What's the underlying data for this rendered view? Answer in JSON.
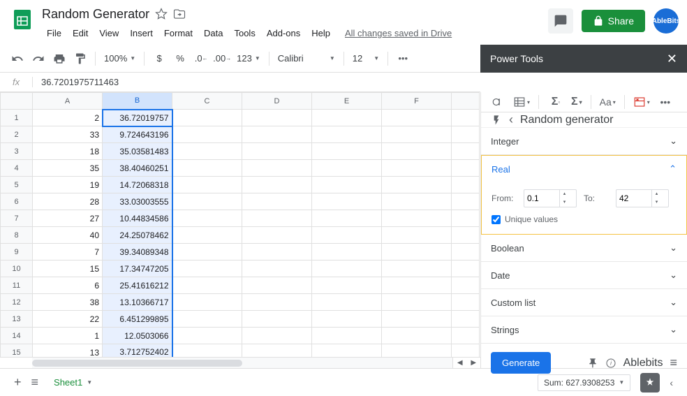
{
  "header": {
    "title": "Random Generator",
    "menus": [
      "File",
      "Edit",
      "View",
      "Insert",
      "Format",
      "Data",
      "Tools",
      "Add-ons",
      "Help"
    ],
    "save_status": "All changes saved in Drive",
    "share_label": "Share",
    "avatar": "AbleBits"
  },
  "toolbar": {
    "zoom": "100%",
    "currency": "$",
    "percent": "%",
    "dec_dec": ".0",
    "dec_inc": ".00",
    "num_format": "123",
    "font": "Calibri",
    "font_size": "12"
  },
  "formula_bar": {
    "fx": "fx",
    "value": "36.7201975711463"
  },
  "columns": [
    "A",
    "B",
    "C",
    "D",
    "E",
    "F"
  ],
  "rows": [
    {
      "n": 1,
      "a": "2",
      "b": "36.72019757"
    },
    {
      "n": 2,
      "a": "33",
      "b": "9.724643196"
    },
    {
      "n": 3,
      "a": "18",
      "b": "35.03581483"
    },
    {
      "n": 4,
      "a": "35",
      "b": "38.40460251"
    },
    {
      "n": 5,
      "a": "19",
      "b": "14.72068318"
    },
    {
      "n": 6,
      "a": "28",
      "b": "33.03003555"
    },
    {
      "n": 7,
      "a": "27",
      "b": "10.44834586"
    },
    {
      "n": 8,
      "a": "40",
      "b": "24.25078462"
    },
    {
      "n": 9,
      "a": "7",
      "b": "39.34089348"
    },
    {
      "n": 10,
      "a": "15",
      "b": "17.34747205"
    },
    {
      "n": 11,
      "a": "6",
      "b": "25.41616212"
    },
    {
      "n": 12,
      "a": "38",
      "b": "13.10366717"
    },
    {
      "n": 13,
      "a": "22",
      "b": "6.451299895"
    },
    {
      "n": 14,
      "a": "1",
      "b": "12.0503066"
    },
    {
      "n": 15,
      "a": "13",
      "b": "3.712752402"
    }
  ],
  "sidebar": {
    "title": "Power Tools",
    "nav_title": "Random generator",
    "sections": {
      "integer": "Integer",
      "real": "Real",
      "boolean": "Boolean",
      "date": "Date",
      "custom": "Custom list",
      "strings": "Strings"
    },
    "real": {
      "from_label": "From:",
      "from_value": "0.1",
      "to_label": "To:",
      "to_value": "42",
      "unique_label": "Unique values"
    },
    "generate_label": "Generate",
    "brand": "Ablebits"
  },
  "bottom": {
    "sheet_name": "Sheet1",
    "sum": "Sum: 627.9308253"
  }
}
